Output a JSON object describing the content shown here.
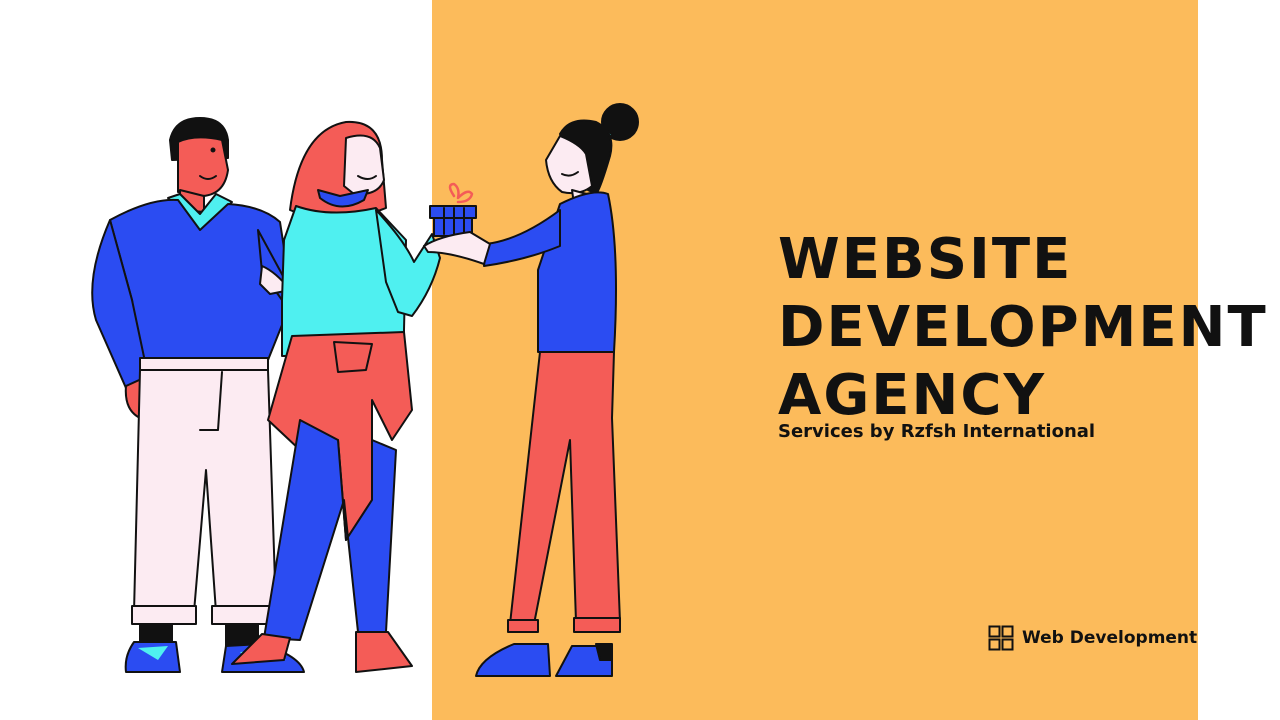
{
  "headline": {
    "line1": "WEBSITE",
    "line2": "DEVELOPMENT",
    "line3": "AGENCY"
  },
  "subtitle": "Services by Rzfsh International",
  "badge": {
    "icon": "grid-icon",
    "label": "Web Development"
  },
  "colors": {
    "panel": "#FCBB5B",
    "blue": "#2B4CF2",
    "cyan": "#4FF0F0",
    "coral": "#F45C57",
    "pale_pink": "#FCEBF2",
    "ink": "#111111"
  }
}
